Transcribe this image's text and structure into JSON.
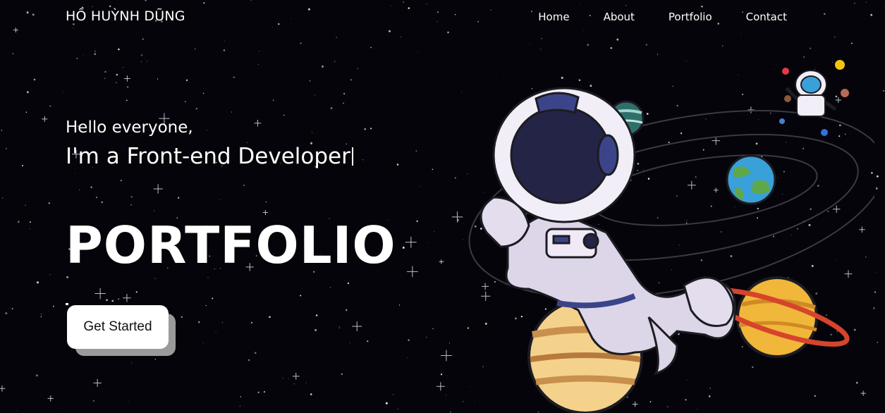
{
  "brand": "HỒ HUỲNH DŨNG",
  "nav": [
    {
      "label": "Home"
    },
    {
      "label": "About"
    },
    {
      "label": "Portfolio"
    },
    {
      "label": "Contact"
    }
  ],
  "hero": {
    "greeting": "Hello everyone,",
    "role": "I'm a Front-end Developer",
    "title": "PORTFOLIO",
    "cta": "Get Started"
  },
  "colors": {
    "background": "#05040a",
    "text": "#ffffff",
    "button_bg": "#ffffff",
    "button_shadow": "#9a9a9a"
  },
  "icons": [
    "astronaut-illustration",
    "planet-icon",
    "star-icon"
  ]
}
